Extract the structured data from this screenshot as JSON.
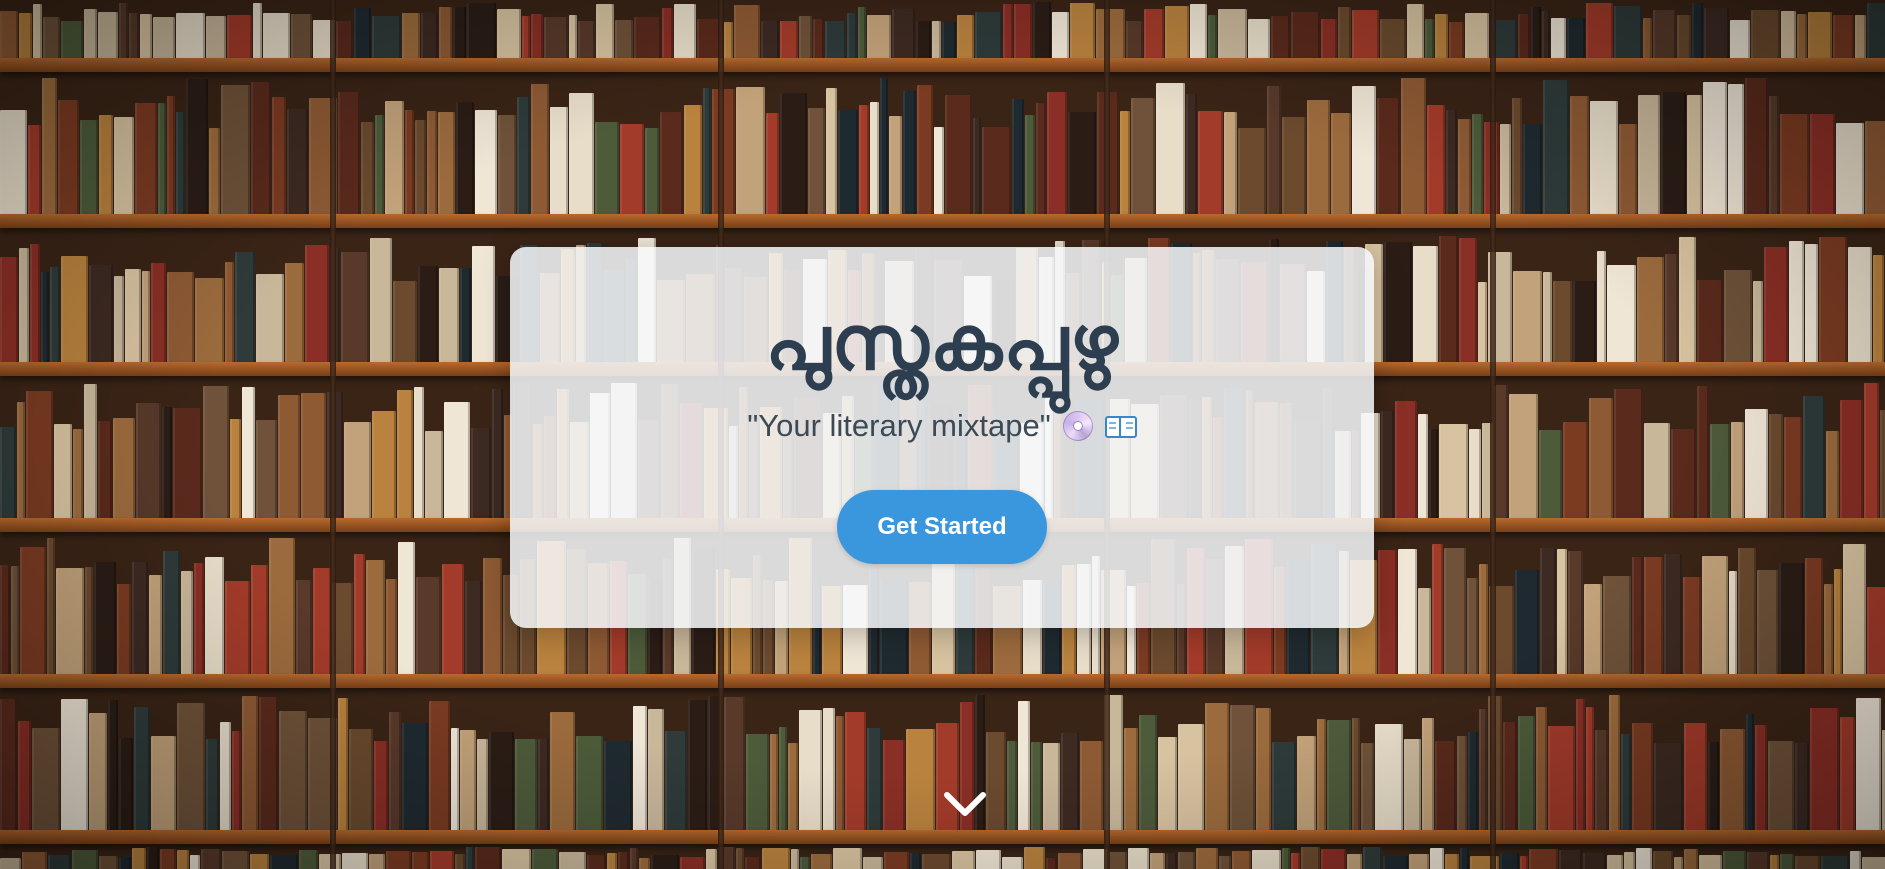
{
  "hero": {
    "title": "പുസ്തകപ്പുഴു",
    "tagline": "\"Your literary mixtape\"",
    "tagline_icons": [
      "cd-icon",
      "open-book-icon"
    ],
    "cta_label": "Get Started",
    "scroll_icon": "chevron-down-icon"
  },
  "colors": {
    "title": "#2c3e50",
    "tagline": "#3b4a55",
    "button": "#3a96dd",
    "card": "rgba(246,248,250,0.86)"
  }
}
